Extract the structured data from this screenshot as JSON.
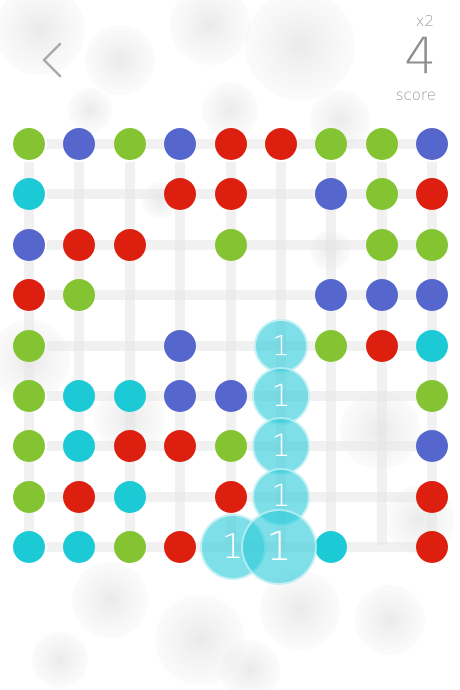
{
  "header": {
    "back_icon": "chevron-left-icon",
    "multiplier": "x2",
    "score_value": "4",
    "score_label": "score"
  },
  "colors": {
    "green": "#84c331",
    "blue": "#5566cc",
    "red": "#dc1f0f",
    "cyan": "#1ccad6",
    "gridline": "#e6e6e6"
  },
  "board": {
    "rows": [
      [
        "green",
        "blue",
        "green",
        "blue",
        "red",
        "red",
        "green",
        "green",
        "blue"
      ],
      [
        "cyan",
        null,
        null,
        "red",
        "red",
        null,
        "blue",
        "green",
        "red"
      ],
      [
        "blue",
        "red",
        "red",
        null,
        "green",
        null,
        null,
        "green",
        "green"
      ],
      [
        "red",
        "green",
        null,
        null,
        null,
        null,
        "blue",
        "blue",
        "blue"
      ],
      [
        "green",
        null,
        null,
        "blue",
        null,
        "badge",
        "green",
        "red",
        "cyan"
      ],
      [
        "green",
        "cyan",
        "cyan",
        "blue",
        "blue",
        "badge",
        null,
        null,
        "green"
      ],
      [
        "green",
        "cyan",
        "red",
        "red",
        "green",
        "badge",
        null,
        null,
        "blue"
      ],
      [
        "green",
        "red",
        "cyan",
        null,
        "red",
        "badge",
        null,
        null,
        "red"
      ],
      [
        "cyan",
        "cyan",
        "green",
        "red",
        "badge",
        "badge",
        "cyan",
        null,
        "red"
      ]
    ],
    "badges": [
      {
        "row": 4,
        "col": 5,
        "value": "1"
      },
      {
        "row": 5,
        "col": 5,
        "value": "1"
      },
      {
        "row": 6,
        "col": 5,
        "value": "1"
      },
      {
        "row": 7,
        "col": 5,
        "value": "1"
      },
      {
        "row": 8,
        "col": 4,
        "value": "1"
      },
      {
        "row": 8,
        "col": 5,
        "value": "1"
      }
    ]
  }
}
